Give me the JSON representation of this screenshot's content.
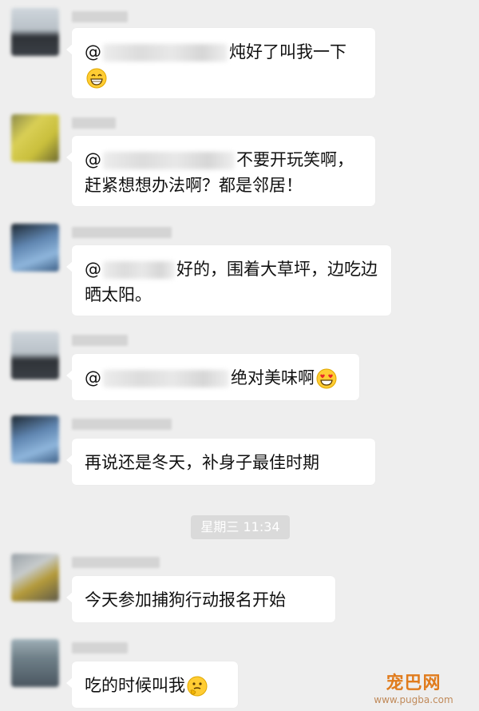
{
  "messages": [
    {
      "mention": "@",
      "text": "炖好了叫我一下",
      "emoji": "grinning-face-icon"
    },
    {
      "mention": "@",
      "text": "不要开玩笑啊，赶紧想想办法啊？都是邻居！"
    },
    {
      "mention": "@",
      "text": "好的，围着大草坪，边吃边晒太阳。"
    },
    {
      "mention": "@",
      "text": "绝对美味啊",
      "emoji": "heart-eyes-face-icon"
    },
    {
      "text": "再说还是冬天，补身子最佳时期"
    },
    {
      "text": "今天参加捕狗行动报名开始"
    },
    {
      "text": "吃的时候叫我",
      "emoji": "thinking-face-icon"
    }
  ],
  "timestamp": "星期三 11:34",
  "watermark": {
    "logo": "宠巴网",
    "url": "www.pugba.com"
  },
  "colors": {
    "background": "#eeeeee",
    "bubble": "#ffffff",
    "watermark": "#e07b1c"
  }
}
